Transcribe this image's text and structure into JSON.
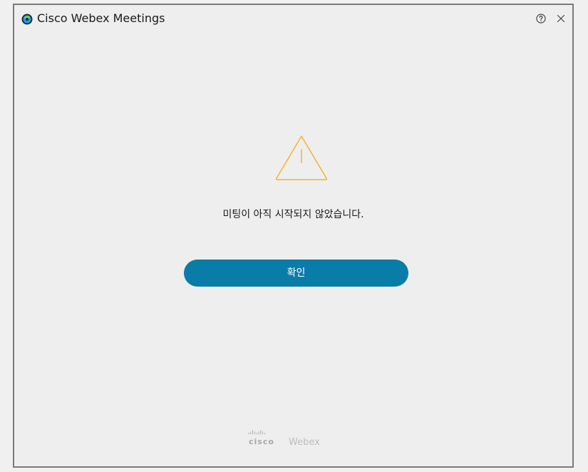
{
  "window": {
    "title": "Cisco Webex Meetings",
    "app_icon": "webex-logo-icon",
    "help_icon": "help-circle-icon",
    "close_icon": "close-icon"
  },
  "dialog": {
    "icon": "warning-triangle-icon",
    "message": "미팅이 아직 시작되지 않았습니다.",
    "ok_label": "확인"
  },
  "footer": {
    "brand": "cisco",
    "product": "Webex"
  },
  "colors": {
    "accent": "#0a7ca8",
    "warning": "#f0b323",
    "background": "#eeeeee"
  }
}
